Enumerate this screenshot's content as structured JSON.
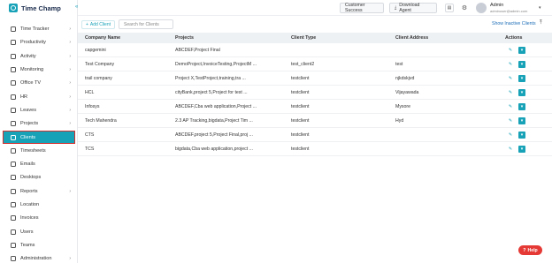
{
  "brand": {
    "name": "Time Champ"
  },
  "sidebar": {
    "items": [
      {
        "label": "Time Tracker",
        "icon": "clock-icon",
        "arrow": true
      },
      {
        "label": "Productivity",
        "icon": "chart-icon",
        "arrow": true
      },
      {
        "label": "Activity",
        "icon": "activity-icon",
        "arrow": true
      },
      {
        "label": "Monitoring",
        "icon": "monitor-icon",
        "arrow": true
      },
      {
        "label": "Office TV",
        "icon": "tv-icon",
        "arrow": true
      },
      {
        "label": "HR",
        "icon": "hr-icon",
        "arrow": true
      },
      {
        "label": "Leaves",
        "icon": "calendar-icon",
        "arrow": true
      },
      {
        "label": "Projects",
        "icon": "folder-icon",
        "arrow": true
      },
      {
        "label": "Clients",
        "icon": "person-icon",
        "arrow": false,
        "active": true
      },
      {
        "label": "Timesheets",
        "icon": "timesheet-icon",
        "arrow": false
      },
      {
        "label": "Emails",
        "icon": "mail-icon",
        "arrow": false
      },
      {
        "label": "Desktops",
        "icon": "desktop-icon",
        "arrow": false
      },
      {
        "label": "Reports",
        "icon": "report-icon",
        "arrow": true
      },
      {
        "label": "Location",
        "icon": "location-icon",
        "arrow": false
      },
      {
        "label": "Invoices",
        "icon": "invoice-icon",
        "arrow": false
      },
      {
        "label": "Users",
        "icon": "users-icon",
        "arrow": false
      },
      {
        "label": "Teams",
        "icon": "teams-icon",
        "arrow": false
      },
      {
        "label": "Administration",
        "icon": "gear-icon",
        "arrow": true
      }
    ]
  },
  "header": {
    "customer_success": "Customer Success",
    "download_agent": "Download Agent",
    "user_name": "Admin",
    "user_email": "adminuser@admin.com"
  },
  "toolbar": {
    "add_client": "Add Client",
    "search_placeholder": "Search for Clients",
    "show_inactive": "Show Inactive Clients"
  },
  "table": {
    "headers": [
      "Company Name",
      "Projects",
      "Client Type",
      "Client Address",
      "Actions"
    ],
    "rows": [
      [
        "capgemini",
        "ABCDEF,Project Final",
        "",
        ""
      ],
      [
        "Test Company",
        "DemoProject,InvoiceTesting,ProjectM ...",
        "test_client2",
        "test"
      ],
      [
        "trail company",
        "Project X,TestProject,training,tra ...",
        "testclient",
        "njkdskjvd"
      ],
      [
        "HCL",
        "cityBank,project 5,Project for test ...",
        "testclient",
        "Vijayawada"
      ],
      [
        "Infosys",
        "ABCDEF,Cba web application,Project ...",
        "testclient",
        "Mysore"
      ],
      [
        "Tech Mahendra",
        "2.3 AP Tracking,bigdata,Project Tim ...",
        "testclient",
        "Hyd"
      ],
      [
        "CTS",
        "ABCDEF,project 5,Project Final,proj ...",
        "testclient",
        ""
      ],
      [
        "TCS",
        "bigdata,Cba web application,project ...",
        "testclient",
        ""
      ]
    ]
  },
  "help": {
    "label": "Help"
  },
  "colors": {
    "accent": "#17a2b8",
    "help": "#e53935",
    "link": "#1e6fb8"
  }
}
